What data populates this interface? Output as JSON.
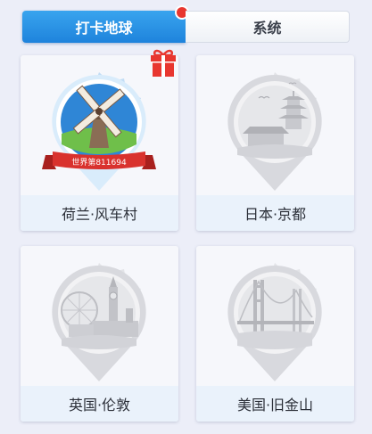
{
  "tabs": [
    {
      "label": "打卡地球",
      "active": true
    },
    {
      "label": "系统",
      "active": false
    }
  ],
  "cards": [
    {
      "label": "荷兰·风车村",
      "unlocked": true,
      "badge_text": "世界第811694",
      "icon": "windmill-badge"
    },
    {
      "label": "日本·京都",
      "unlocked": false,
      "icon": "kyoto-pagoda-badge"
    },
    {
      "label": "英国·伦敦",
      "unlocked": false,
      "icon": "london-bigben-badge"
    },
    {
      "label": "美国·旧金山",
      "unlocked": false,
      "icon": "goldengate-bridge-badge"
    }
  ],
  "colors": {
    "tab_active": "#1e83dc",
    "notification": "#e8362f",
    "ribbon": "#d9322e",
    "gift": "#e8362f"
  }
}
